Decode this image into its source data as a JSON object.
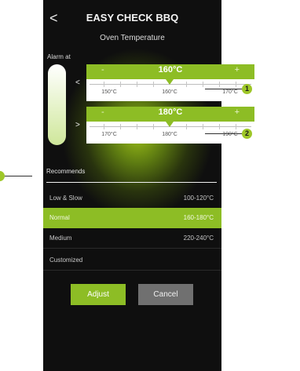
{
  "header": {
    "back_symbol": "<",
    "title": "EASY CHECK BBQ",
    "subtitle": "Oven Temperature"
  },
  "alarm": {
    "label": "Alarm at",
    "sliders": [
      {
        "comparator": "<",
        "minus": "-",
        "plus": "+",
        "value": "160°C",
        "ticks": [
          "150°C",
          "160°C",
          "170°C"
        ],
        "callout": "1"
      },
      {
        "comparator": ">",
        "minus": "-",
        "plus": "+",
        "value": "180°C",
        "ticks": [
          "170°C",
          "180°C",
          "190°C"
        ],
        "callout": "2"
      }
    ]
  },
  "recommends": {
    "title": "Recommends",
    "options": [
      {
        "name": "Low & Slow",
        "range": "100-120°C",
        "selected": false
      },
      {
        "name": "Normal",
        "range": "160-180°C",
        "selected": true
      },
      {
        "name": "Medium",
        "range": "220-240°C",
        "selected": false
      },
      {
        "name": "Customized",
        "range": "",
        "selected": false
      }
    ]
  },
  "actions": {
    "adjust_label": "Adjust",
    "cancel_label": "Cancel"
  },
  "colors": {
    "accent": "#8dbd25",
    "background": "#0f0f0f",
    "cancel": "#707070"
  }
}
